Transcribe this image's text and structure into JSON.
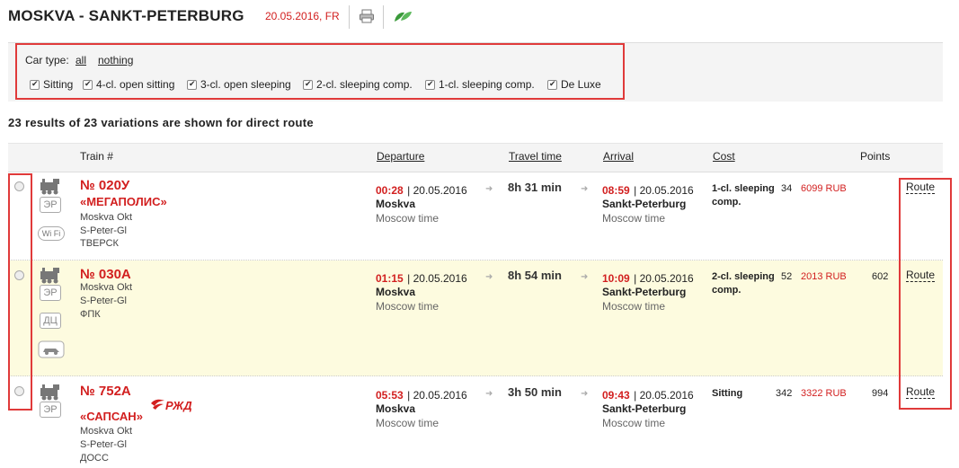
{
  "header": {
    "route": "MOSKVA - SANKT-PETERBURG",
    "date": "20.05.2016, FR"
  },
  "filter": {
    "label": "Car type:",
    "all": "all",
    "nothing": "nothing",
    "options": [
      "Sitting",
      "4-cl. open sitting",
      "3-cl. open sleeping",
      "2-cl. sleeping comp.",
      "1-cl. sleeping comp.",
      "De Luxe"
    ]
  },
  "results": "23 results of 23 variations are shown for direct route",
  "columns": {
    "train": "Train #",
    "departure": "Departure",
    "travel": "Travel time",
    "arrival": "Arrival",
    "cost": "Cost",
    "points": "Points"
  },
  "icons": {
    "er": "ЭР",
    "dc": "ДЦ",
    "wifi": "Wi Fi",
    "brand": "РЖД"
  },
  "trains": [
    {
      "number": "№ 020У",
      "name": "«МЕГАПОЛИС»",
      "from": "Moskva Okt",
      "to": "S-Peter-Gl",
      "carrier": "ТВЕРСК",
      "dep_time": "00:28",
      "dep_date": "| 20.05.2016",
      "dep_station": "Moskva",
      "dep_tz": "Moscow time",
      "travel": "8h 31 min",
      "arr_time": "08:59",
      "arr_date": "| 20.05.2016",
      "arr_station": "Sankt-Peterburg",
      "arr_tz": "Moscow time",
      "cost_type": "1-cl. sleeping comp.",
      "seats": "34",
      "price": "6099 RUB",
      "points": "",
      "route": "Route"
    },
    {
      "number": "№ 030А",
      "name": "",
      "from": "Moskva Okt",
      "to": "S-Peter-Gl",
      "carrier": "ФПК",
      "dep_time": "01:15",
      "dep_date": "| 20.05.2016",
      "dep_station": "Moskva",
      "dep_tz": "Moscow time",
      "travel": "8h 54 min",
      "arr_time": "10:09",
      "arr_date": "| 20.05.2016",
      "arr_station": "Sankt-Peterburg",
      "arr_tz": "Moscow time",
      "cost_type": "2-cl. sleeping comp.",
      "seats": "52",
      "price": "2013 RUB",
      "points": "602",
      "route": "Route"
    },
    {
      "number": "№ 752А",
      "name": "«САПСАН»",
      "from": "Moskva Okt",
      "to": "S-Peter-Gl",
      "carrier": "ДОСС",
      "dep_time": "05:53",
      "dep_date": "| 20.05.2016",
      "dep_station": "Moskva",
      "dep_tz": "Moscow time",
      "travel": "3h 50 min",
      "arr_time": "09:43",
      "arr_date": "| 20.05.2016",
      "arr_station": "Sankt-Peterburg",
      "arr_tz": "Moscow time",
      "cost_type": "Sitting",
      "seats": "342",
      "price": "3322 RUB",
      "points": "994",
      "route": "Route"
    }
  ]
}
